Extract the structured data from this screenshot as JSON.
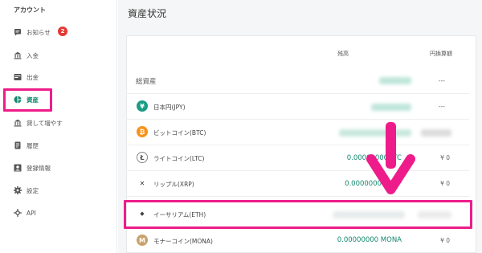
{
  "sidebar": {
    "section_title": "アカウント",
    "items": [
      {
        "label": "お知らせ",
        "icon": "message-icon",
        "badge": "2"
      },
      {
        "label": "入金",
        "icon": "bank-icon"
      },
      {
        "label": "出金",
        "icon": "withdraw-icon"
      },
      {
        "label": "資産",
        "icon": "pie-chart-icon",
        "active": true
      },
      {
        "label": "貸して増やす",
        "icon": "lend-icon"
      },
      {
        "label": "履歴",
        "icon": "history-icon"
      },
      {
        "label": "登録情報",
        "icon": "account-box-icon"
      },
      {
        "label": "設定",
        "icon": "gear-icon"
      },
      {
        "label": "API",
        "icon": "api-icon"
      }
    ]
  },
  "main": {
    "title": "資産状況",
    "columns": {
      "balance": "残高",
      "yen_value": "円換算額"
    },
    "total": {
      "label": "総資産",
      "yen": "---"
    },
    "assets": [
      {
        "name": "日本円(JPY)",
        "icon": "yen-icon",
        "icon_text": "¥",
        "amount": "",
        "yen": "---"
      },
      {
        "name": "ビットコイン(BTC)",
        "icon": "btc-icon",
        "icon_text": "₿",
        "amount": "",
        "yen": ""
      },
      {
        "name": "ライトコイン(LTC)",
        "icon": "ltc-icon",
        "icon_text": "Ł",
        "amount": "0.00000000 LTC",
        "yen": "¥ 0"
      },
      {
        "name": "リップル(XRP)",
        "icon": "xrp-icon",
        "icon_text": "✕",
        "amount": "0.00000000 XRP",
        "yen": "¥ 0"
      },
      {
        "name": "イーサリアム(ETH)",
        "icon": "eth-icon",
        "icon_text": "◆",
        "amount": "",
        "yen": ""
      },
      {
        "name": "モナーコイン(MONA)",
        "icon": "mona-icon",
        "icon_text": "M",
        "amount": "0.00000000 MONA",
        "yen": "¥ 0"
      }
    ]
  },
  "colors": {
    "accent": "#12876d",
    "highlight": "#ee1c8a",
    "badge": "#e53935",
    "btc": "#f7931a",
    "jpy": "#1a9c84",
    "mona": "#c9a26a"
  }
}
